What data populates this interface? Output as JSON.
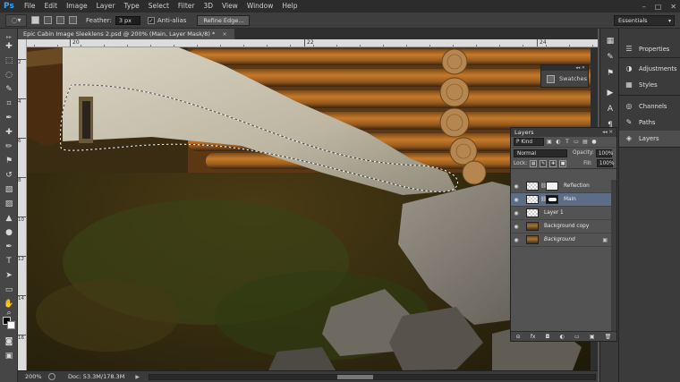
{
  "app": {
    "logo": "Ps",
    "menu": [
      "File",
      "Edit",
      "Image",
      "Layer",
      "Type",
      "Select",
      "Filter",
      "3D",
      "View",
      "Window",
      "Help"
    ],
    "window_controls": [
      "–",
      "□",
      "✕"
    ]
  },
  "options_bar": {
    "feather_label": "Feather:",
    "feather_value": "3 px",
    "antialias_label": "Anti-alias",
    "antialias_checked": true,
    "refine_edge_label": "Refine Edge...",
    "workspace": "Essentials"
  },
  "document": {
    "tab_title": "Epic Cabin Image Sleeklens 2.psd @ 200% (Main, Layer Mask/8) *",
    "tab_close": "×",
    "ruler_top_labels": [
      "20",
      "22",
      "24"
    ],
    "ruler_left_labels": [
      "2",
      "4",
      "6",
      "8",
      "10",
      "12",
      "14",
      "16"
    ]
  },
  "status": {
    "zoom": "200%",
    "doc_info": "Doc: 53.3M/178.3M",
    "arrow": "▶"
  },
  "right_panels": [
    {
      "name": "Properties",
      "icon": "properties-icon",
      "glyph": "☰"
    },
    {
      "name": "Adjustments",
      "icon": "adjustments-icon",
      "glyph": "◑"
    },
    {
      "name": "Styles",
      "icon": "styles-icon",
      "glyph": "▦"
    },
    {
      "name": "Channels",
      "icon": "channels-icon",
      "glyph": "◎"
    },
    {
      "name": "Paths",
      "icon": "paths-icon",
      "glyph": "✎"
    },
    {
      "name": "Layers",
      "icon": "layers-icon",
      "glyph": "◈"
    }
  ],
  "swatches_panel": {
    "label": "Swatches",
    "controls": "◂◂ ✕"
  },
  "layers_panel": {
    "title": "Layers",
    "title_controls": "◂◂ ✕",
    "kind": "P Kind",
    "blend_mode": "Normal",
    "opacity_label": "Opacity:",
    "opacity": "100%",
    "lock_label": "Lock:",
    "fill_label": "Fill:",
    "fill": "100%",
    "layers": [
      {
        "name": "Reflection",
        "thumb": "checker",
        "mask": "white",
        "selected": false,
        "locked": false,
        "italic": false
      },
      {
        "name": "Main",
        "thumb": "checker",
        "mask": "blob",
        "selected": true,
        "locked": false,
        "italic": false
      },
      {
        "name": "Layer 1",
        "thumb": "checker",
        "mask": "",
        "selected": false,
        "locked": false,
        "italic": false
      },
      {
        "name": "Background copy",
        "thumb": "photo",
        "mask": "",
        "selected": false,
        "locked": false,
        "italic": false
      },
      {
        "name": "Background",
        "thumb": "photo",
        "mask": "",
        "selected": false,
        "locked": true,
        "italic": true
      }
    ],
    "footer_icons": [
      "link-icon",
      "fx-icon",
      "mask-icon",
      "adjustment-icon",
      "group-icon",
      "new-layer-icon",
      "trash-icon"
    ],
    "footer_glyphs": [
      "⊝",
      "fx",
      "◘",
      "◐",
      "▭",
      "▣",
      "🗑"
    ]
  },
  "colors": {
    "menubar": "#2c2c2c",
    "panel": "#535353",
    "selected_layer": "#5e6d86",
    "ps_blue": "#31a8ff"
  }
}
